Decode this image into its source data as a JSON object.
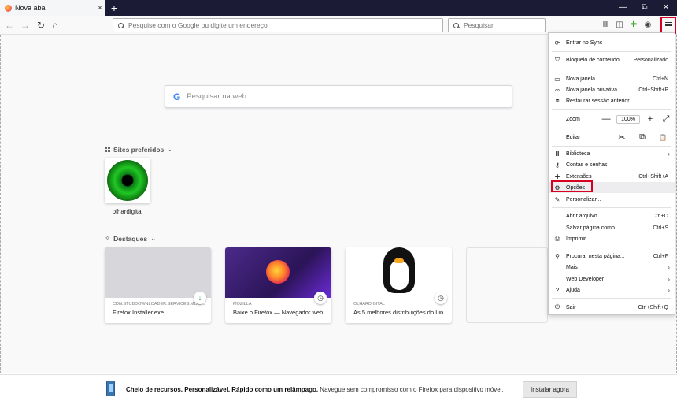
{
  "tab": {
    "title": "Nova aba",
    "close": "×",
    "new_tab": "+"
  },
  "window_controls": [
    "—",
    "⧉",
    "✕"
  ],
  "navbar": {
    "back": "←",
    "forward": "→",
    "reload": "↻",
    "home": "⌂",
    "url_placeholder": "Pesquise com o Google ou digite um endereço",
    "search_placeholder": "Pesquisar"
  },
  "content": {
    "search_placeholder": "Pesquisar na web",
    "google_glyph": "G",
    "search_arrow": "→",
    "top_sites_header": "Sites preferidos",
    "top_sites": [
      {
        "label": "olhardigital"
      }
    ],
    "highlights_header": "Destaques",
    "cards": [
      {
        "source": "CDN.STUBDOWNLOADER.SERVICES.MOZI...",
        "title": "Firefox Installer.exe"
      },
      {
        "source": "MOZILLA",
        "title": "Baixe o Firefox — Navegador web ..."
      },
      {
        "source": "OLHARDIGITAL",
        "title": "As 5 melhores distribuições do Lin..."
      }
    ]
  },
  "menu": {
    "items": [
      {
        "label": "Entrar no Sync",
        "icon": "sync-icon",
        "shortcut": ""
      },
      {
        "label": "Bloqueio de conteúdo",
        "icon": "shield-icon",
        "shortcut": "Personalizado"
      },
      {
        "label": "Nova janela",
        "icon": "window-icon",
        "shortcut": "Ctrl+N"
      },
      {
        "label": "Nova janela privativa",
        "icon": "mask-icon",
        "shortcut": "Ctrl+Shift+P"
      },
      {
        "label": "Restaurar sessão anterior",
        "icon": "restore-icon",
        "shortcut": ""
      },
      {
        "label": "Biblioteca",
        "icon": "library-icon",
        "shortcut": ""
      },
      {
        "label": "Contas e senhas",
        "icon": "key-icon",
        "shortcut": ""
      },
      {
        "label": "Extensões",
        "icon": "puzzle-icon",
        "shortcut": "Ctrl+Shift+A"
      },
      {
        "label": "Opções",
        "icon": "gear-icon",
        "shortcut": ""
      },
      {
        "label": "Personalizar...",
        "icon": "brush-icon",
        "shortcut": ""
      },
      {
        "label": "Abrir arquivo...",
        "icon": "",
        "shortcut": "Ctrl+O"
      },
      {
        "label": "Salvar página como...",
        "icon": "",
        "shortcut": "Ctrl+S"
      },
      {
        "label": "Imprimir...",
        "icon": "print-icon",
        "shortcut": ""
      },
      {
        "label": "Procurar nesta página...",
        "icon": "search-icon",
        "shortcut": "Ctrl+F"
      },
      {
        "label": "Mais",
        "icon": "",
        "shortcut": ""
      },
      {
        "label": "Web Developer",
        "icon": "",
        "shortcut": ""
      },
      {
        "label": "Ajuda",
        "icon": "help-icon",
        "shortcut": ""
      },
      {
        "label": "Sair",
        "icon": "power-icon",
        "shortcut": "Ctrl+Shift+Q"
      }
    ],
    "zoom": {
      "label": "Zoom",
      "minus": "—",
      "value": "100%",
      "plus": "+",
      "fullscreen": "⤢"
    },
    "edit": {
      "label": "Editar",
      "cut": "✂",
      "copy": "⧉",
      "paste": "📋"
    }
  },
  "notification": {
    "bold": "Cheio de recursos. Personalizável. Rápido como um relâmpago.",
    "text": " Navegue sem compromisso com o Firefox para dispositivo móvel.",
    "button": "Instalar agora"
  },
  "colors": {
    "highlight": "#d70022",
    "titlebar": "#1c1b36"
  }
}
